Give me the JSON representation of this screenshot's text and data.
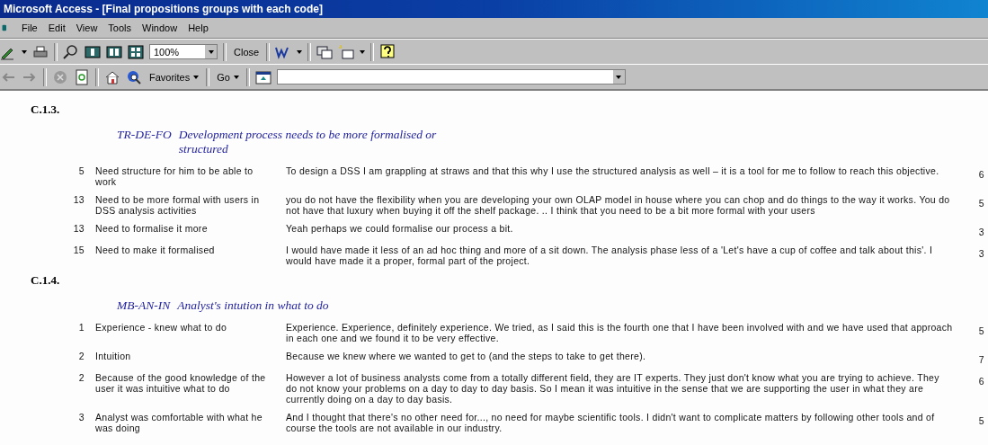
{
  "window": {
    "title": "Microsoft Access - [Final propositions groups with each code]"
  },
  "menu": [
    "File",
    "Edit",
    "View",
    "Tools",
    "Window",
    "Help"
  ],
  "toolbar": {
    "zoom": "100%",
    "close": "Close"
  },
  "web_toolbar": {
    "favorites": "Favorites",
    "go": "Go"
  },
  "sections": [
    {
      "heading": "C.1.3.",
      "code": "TR-DE-FO",
      "title": "Development process needs to be more formalised or structured",
      "rows": [
        {
          "number": "5",
          "summary": "Need structure for him to be able to work",
          "quote": "To design a DSS I am grappling at straws and that this why I use the structured analysis as well – it is a tool for me to follow to reach this objective.",
          "count": "6"
        },
        {
          "number": "13",
          "summary": "Need to be more formal with users in DSS analysis activities",
          "quote": "you do not have the flexibility when you are developing your own OLAP model in house where you can chop and do things to the way it works.  You do not have that luxury when buying it off the shelf package.  .. I think that you need to be a bit more formal with your users",
          "count": "5"
        },
        {
          "number": "13",
          "summary": "Need to formalise it more",
          "quote": "Yeah perhaps we could formalise our process a bit.",
          "count": "3"
        },
        {
          "number": "15",
          "summary": "Need to make it formalised",
          "quote": "I would have made it less of an ad hoc thing and more of a sit down.  The analysis phase less of a 'Let's have a cup of coffee and talk about this'.  I would have made it a proper, formal part of the project.",
          "count": "3"
        }
      ]
    },
    {
      "heading": "C.1.4.",
      "code": "MB-AN-IN",
      "title": "Analyst's intution in what to do",
      "rows": [
        {
          "number": "1",
          "summary": "Experience - knew what to do",
          "quote": "Experience.  Experience, definitely experience.  We tried, as I said this is the fourth one that I have been involved with and we have used that approach in each one and we found it to be very effective.",
          "count": "5"
        },
        {
          "number": "2",
          "summary": "Intuition",
          "quote": "Because we knew where we wanted to get to (and the steps to take to get there).",
          "count": "7"
        },
        {
          "number": "2",
          "summary": "Because of the good knowledge of the user it was intuitive what to do",
          "quote": "However a lot of business analysts come from a totally different field, they are IT experts.  They just don't know what you are trying to achieve.  They do not know your problems on a day to day to day basis.  So I mean it was intuitive in the sense that we are supporting the user in what they are currently doing on a day to day basis.",
          "count": "6"
        },
        {
          "number": "3",
          "summary": "Analyst was comfortable with what he was doing",
          "quote": "And I thought that there's no other need for..., no need for maybe scientific tools.  I didn't want to complicate matters by following other tools and of course the tools are not available in our industry.",
          "count": "5"
        }
      ]
    }
  ]
}
